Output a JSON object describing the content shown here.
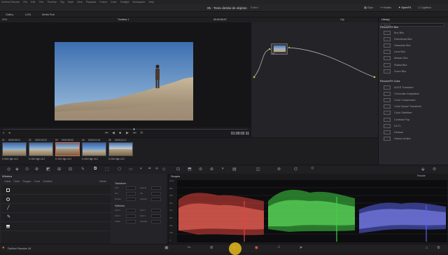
{
  "app": {
    "menu": [
      "DaVinci Resolve",
      "File",
      "Edit",
      "Trim",
      "Timeline",
      "Clip",
      "Mark",
      "View",
      "Playback",
      "Fusion",
      "Color",
      "Fairlight",
      "Workspace",
      "Help"
    ],
    "project_title": "05 - Texto detrás de objetos",
    "edited_label": "Edited",
    "top_right": [
      "Clips",
      "Nodes",
      "OpenFX",
      "Lightbox"
    ]
  },
  "toolbar2": {
    "left": [
      "Gallery",
      "LUTs",
      "Media Pool"
    ],
    "zoom": "31%",
    "timeline_name": "Timeline 1",
    "timecode": "00:00:06:07",
    "clip_label": "Clip",
    "library_tab": "Library",
    "search_placeholder": "Search"
  },
  "viewer": {
    "timecode": "01:00:02:11",
    "transport": [
      "⏮",
      "◀",
      "■",
      "▶",
      "⏭",
      "⟲"
    ]
  },
  "clips": [
    {
      "num": "01",
      "tc": "00:00:03:21",
      "codec": "H.264 High L5.2"
    },
    {
      "num": "02",
      "tc": "00:00:02:22",
      "codec": "H.264 High L5.2"
    },
    {
      "num": "03",
      "tc": "00:00:00:00",
      "codec": "H.264 High L5.2"
    },
    {
      "num": "04",
      "tc": "00:00:10:18",
      "codec": "H.264 High L5.2"
    },
    {
      "num": "05",
      "tc": "00:00:11:17",
      "codec": "H.264 High L5.2"
    }
  ],
  "library": {
    "section1": "ResolveFX Blur",
    "items1": [
      "Box Blur",
      "Directional Blur",
      "Gaussian Blur",
      "Lens Blur",
      "Mosaic Blur",
      "Radial Blur",
      "Zoom Blur"
    ],
    "section2": "ResolveFX Color",
    "items2": [
      "ACES Transform",
      "Chromatic Adaptation",
      "Color Compressor",
      "Color Space Transform",
      "Color Stabilizer",
      "Contrast Pop",
      "DCTL",
      "Dehaze",
      "Gamut Limiter"
    ]
  },
  "window_panel": {
    "title": "Window",
    "tools": [
      "Linear",
      "Circle",
      "Polygon",
      "Curve",
      "Gradient"
    ],
    "right_labels": [
      "Delete"
    ],
    "transform": "Transform",
    "transform_fields": [
      "Size",
      "Aspect",
      "Pan",
      "Tilt",
      "Rotate",
      "Opacity"
    ],
    "softness": "Softness",
    "softness_fields": [
      "Soft 1",
      "Soft 2",
      "Soft 3",
      "Soft 4",
      "Inside",
      "Outside"
    ]
  },
  "scopes": {
    "title": "Scopes",
    "mode": "Parade",
    "ticks": [
      "1023",
      "896",
      "768",
      "640",
      "512",
      "384",
      "256",
      "128",
      "0"
    ]
  },
  "footer": {
    "app_name": "DaVinci Resolve 18"
  },
  "colors": {
    "accent": "#e2643c",
    "red_trace": "#e0443c",
    "green_trace": "#3fd144",
    "blue_trace": "#5a63e8",
    "cursor": "#f2c31b"
  }
}
